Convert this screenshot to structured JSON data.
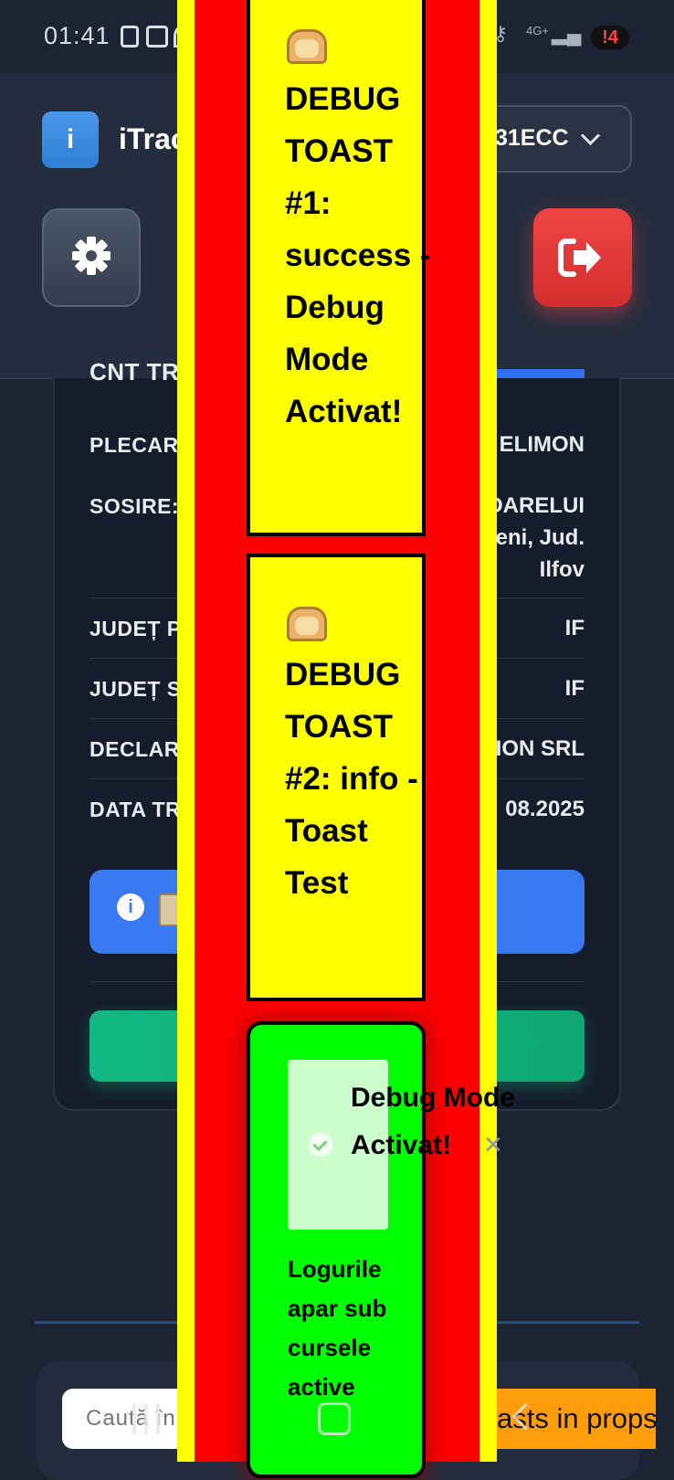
{
  "status_bar": {
    "time": "01:41",
    "network": "4G+",
    "notification_count": "!4"
  },
  "header": {
    "app_title": "iTrac",
    "logo_letter": "i",
    "vehicle_selector_value": "31ECC"
  },
  "trip_card": {
    "top_label": "CNT TR",
    "rows": [
      {
        "label": "PLECARE",
        "value": "ELIMON"
      },
      {
        "label": "SOSIRE:",
        "value_lines": [
          "DARELUI",
          "eni, Jud.",
          "Ilfov"
        ]
      },
      {
        "label": "JUDEȚ P",
        "value": "IF"
      },
      {
        "label": "JUDEȚ S",
        "value": "IF"
      },
      {
        "label": "DECLARA",
        "value": "ION SRL"
      },
      {
        "label": "DATA TR",
        "value": "08.2025"
      }
    ]
  },
  "search": {
    "placeholder": "Caută în"
  },
  "props_tag": "asts in props",
  "debug_toasts": [
    {
      "emoji_name": "bread-icon",
      "text": "DEBUG TOAST #1: success - Debug Mode Activat!"
    },
    {
      "emoji_name": "bread-icon",
      "text": "DEBUG TOAST #2: info - Toast Test"
    }
  ],
  "active_toast": {
    "title": "Debug Mode Activat!",
    "body": "Logurile apar sub cursele active",
    "close_symbol": "×"
  },
  "colors": {
    "overlay_yellow": "#ffff00",
    "overlay_red": "#ff0000",
    "toast_green": "#00ff00",
    "info_blue": "#3878f0",
    "success_green": "#12b881",
    "logout_red": "#ef4444",
    "props_orange": "#ff9e0a"
  }
}
